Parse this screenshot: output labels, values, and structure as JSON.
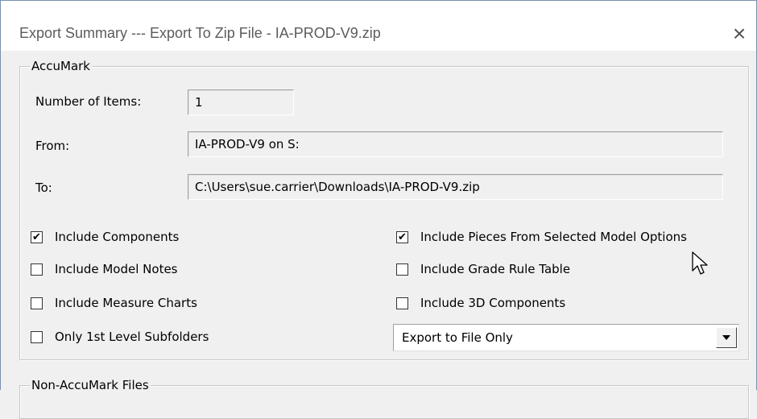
{
  "window": {
    "title": "Export Summary --- Export To Zip File - IA-PROD-V9.zip",
    "close_icon": "close-icon"
  },
  "accumark": {
    "legend": "AccuMark",
    "items_label": "Number of Items:",
    "items_value": "1",
    "from_label": "From:",
    "from_value": "IA-PROD-V9 on S:",
    "to_label": "To:",
    "to_value": "C:\\Users\\sue.carrier\\Downloads\\IA-PROD-V9.zip"
  },
  "options": [
    {
      "label": "Include Components",
      "checked": true
    },
    {
      "label": "Include Model Notes",
      "checked": false
    },
    {
      "label": "Include Measure Charts",
      "checked": false
    },
    {
      "label": "Only 1st Level Subfolders",
      "checked": false
    },
    {
      "label": "Include Pieces From Selected Model Options",
      "checked": true
    },
    {
      "label": "Include Grade Rule Table",
      "checked": false
    },
    {
      "label": "Include 3D Components",
      "checked": false
    }
  ],
  "export_mode": {
    "selected": "Export to File Only",
    "arrow_icon": "chevron-down-icon"
  },
  "non_accumark": {
    "legend": "Non-AccuMark Files"
  },
  "check_glyph": "✔"
}
